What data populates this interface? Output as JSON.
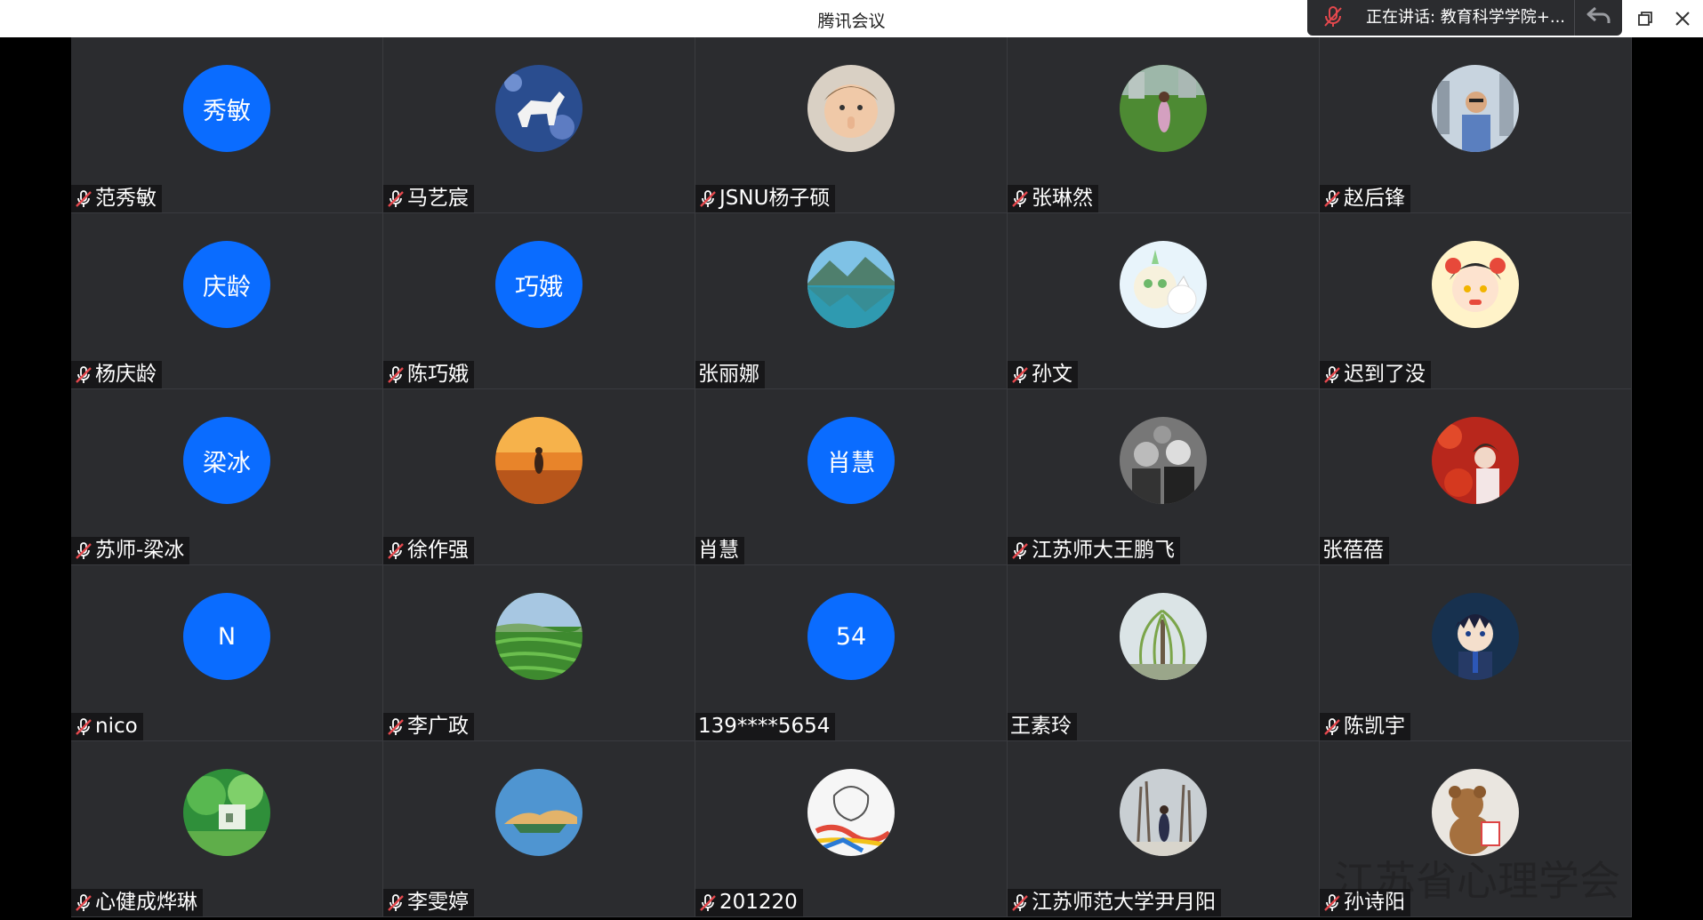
{
  "window": {
    "title": "腾讯会议"
  },
  "speaking": {
    "label": "正在讲话: 教育科学学院+..."
  },
  "colors": {
    "accent": "#0a6cff",
    "tile_bg": "#2b2c2f",
    "mute_red": "#e5484d"
  },
  "participants": [
    {
      "name": "范秀敏",
      "muted": true,
      "avatar_text": "秀敏",
      "avatar_icon": null
    },
    {
      "name": "马艺宸",
      "muted": true,
      "avatar_text": null,
      "avatar_icon": "horse-photo-icon"
    },
    {
      "name": "JSNU杨子硕",
      "muted": true,
      "avatar_text": null,
      "avatar_icon": "baby-photo-icon"
    },
    {
      "name": "张琳然",
      "muted": true,
      "avatar_text": null,
      "avatar_icon": "person-on-grass-photo-icon"
    },
    {
      "name": "赵后锋",
      "muted": true,
      "avatar_text": null,
      "avatar_icon": "man-city-photo-icon"
    },
    {
      "name": "杨庆龄",
      "muted": true,
      "avatar_text": "庆龄",
      "avatar_icon": null
    },
    {
      "name": "陈巧娥",
      "muted": true,
      "avatar_text": "巧娥",
      "avatar_icon": null
    },
    {
      "name": "张丽娜",
      "muted": false,
      "avatar_text": null,
      "avatar_icon": "lake-mountain-photo-icon"
    },
    {
      "name": "孙文",
      "muted": true,
      "avatar_text": null,
      "avatar_icon": "cartoon-cat-icon"
    },
    {
      "name": "迟到了没",
      "muted": true,
      "avatar_text": null,
      "avatar_icon": "cartoon-girl-icon"
    },
    {
      "name": "苏师-梁冰",
      "muted": true,
      "avatar_text": "梁冰",
      "avatar_icon": null
    },
    {
      "name": "徐作强",
      "muted": true,
      "avatar_text": null,
      "avatar_icon": "sunset-field-photo-icon"
    },
    {
      "name": "肖慧",
      "muted": false,
      "avatar_text": "肖慧",
      "avatar_icon": null
    },
    {
      "name": "江苏师大王鹏飞",
      "muted": true,
      "avatar_text": null,
      "avatar_icon": "bw-group-photo-icon"
    },
    {
      "name": "张蓓蓓",
      "muted": false,
      "avatar_text": null,
      "avatar_icon": "woman-red-leaves-photo-icon"
    },
    {
      "name": "nico",
      "muted": true,
      "avatar_text": "N",
      "avatar_icon": null
    },
    {
      "name": "李广政",
      "muted": true,
      "avatar_text": null,
      "avatar_icon": "tea-field-photo-icon"
    },
    {
      "name": "139****5654",
      "muted": false,
      "avatar_text": "54",
      "avatar_icon": null
    },
    {
      "name": "王素玲",
      "muted": false,
      "avatar_text": null,
      "avatar_icon": "willow-tree-photo-icon"
    },
    {
      "name": "陈凯宇",
      "muted": true,
      "avatar_text": null,
      "avatar_icon": "anime-boy-icon"
    },
    {
      "name": "心健成烨琳",
      "muted": true,
      "avatar_text": null,
      "avatar_icon": "anime-forest-house-icon"
    },
    {
      "name": "李雯婷",
      "muted": true,
      "avatar_text": null,
      "avatar_icon": "blue-sky-photo-icon"
    },
    {
      "name": "201220",
      "muted": true,
      "avatar_text": null,
      "avatar_icon": "sketch-drawing-icon"
    },
    {
      "name": "江苏师范大学尹月阳",
      "muted": true,
      "avatar_text": null,
      "avatar_icon": "winter-trees-photo-icon"
    },
    {
      "name": "孙诗阳",
      "muted": true,
      "avatar_text": null,
      "avatar_icon": "teddy-bear-photo-icon"
    }
  ],
  "watermark": {
    "text": "江苏省心理学会"
  }
}
